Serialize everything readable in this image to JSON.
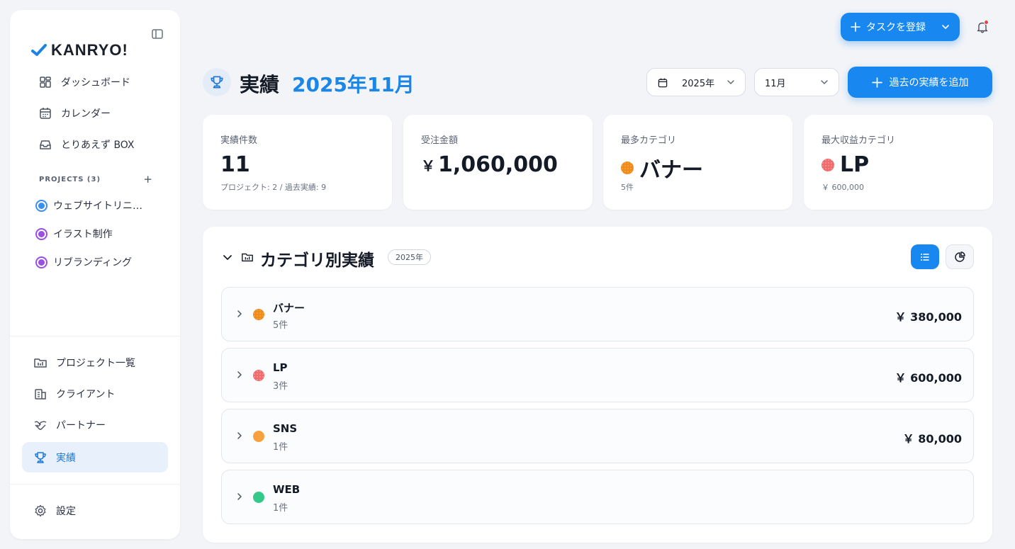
{
  "app": {
    "brand": "KANRYO!",
    "nav_main": [
      {
        "label": "ダッシュボード",
        "icon": "dashboard-icon"
      },
      {
        "label": "カレンダー",
        "icon": "calendar-icon"
      },
      {
        "label": "とりあえず BOX",
        "icon": "inbox-icon"
      }
    ],
    "projects_header": "PROJECTS (3)",
    "projects": [
      {
        "label": "ウェブサイトリニ…",
        "color": "#3b8ef0"
      },
      {
        "label": "イラスト制作",
        "color": "#9b4fe0"
      },
      {
        "label": "リブランディング",
        "color": "#9b4fe0"
      }
    ],
    "nav_secondary": [
      {
        "label": "プロジェクト一覧",
        "icon": "project-list-icon"
      },
      {
        "label": "クライアント",
        "icon": "building-icon"
      },
      {
        "label": "パートナー",
        "icon": "handshake-icon"
      },
      {
        "label": "実績",
        "icon": "trophy-icon",
        "active": true
      }
    ],
    "settings_label": "設定"
  },
  "topbar": {
    "task_button_label": "タスクを登録"
  },
  "header": {
    "title": "実績",
    "period": "2025年11月",
    "year_select": "2025年",
    "month_select": "11月",
    "add_past_label": "過去の実績を追加"
  },
  "stats": [
    {
      "label": "実績件数",
      "value": "11",
      "sub": "プロジェクト: 2 / 過去実績: 9"
    },
    {
      "label": "受注金額",
      "yen": "￥",
      "value": "1,060,000",
      "sub": ""
    },
    {
      "label": "最多カテゴリ",
      "value": "バナー",
      "sub": "5件",
      "dot": "orange"
    },
    {
      "label": "最大収益カテゴリ",
      "value": "LP",
      "sub": "￥ 600,000",
      "dot": "red"
    }
  ],
  "category_panel": {
    "title": "カテゴリ別実績",
    "year_badge": "2025年",
    "rows": [
      {
        "name": "バナー",
        "count": "5件",
        "amount": "￥ 380,000",
        "color": "#f29a2c"
      },
      {
        "name": "LP",
        "count": "3件",
        "amount": "￥ 600,000",
        "color": "#f06b6b"
      },
      {
        "name": "SNS",
        "count": "1件",
        "amount": "￥ 80,000",
        "color": "#f6a13e"
      },
      {
        "name": "WEB",
        "count": "1件",
        "amount": "",
        "color": "#34c98a"
      }
    ]
  }
}
